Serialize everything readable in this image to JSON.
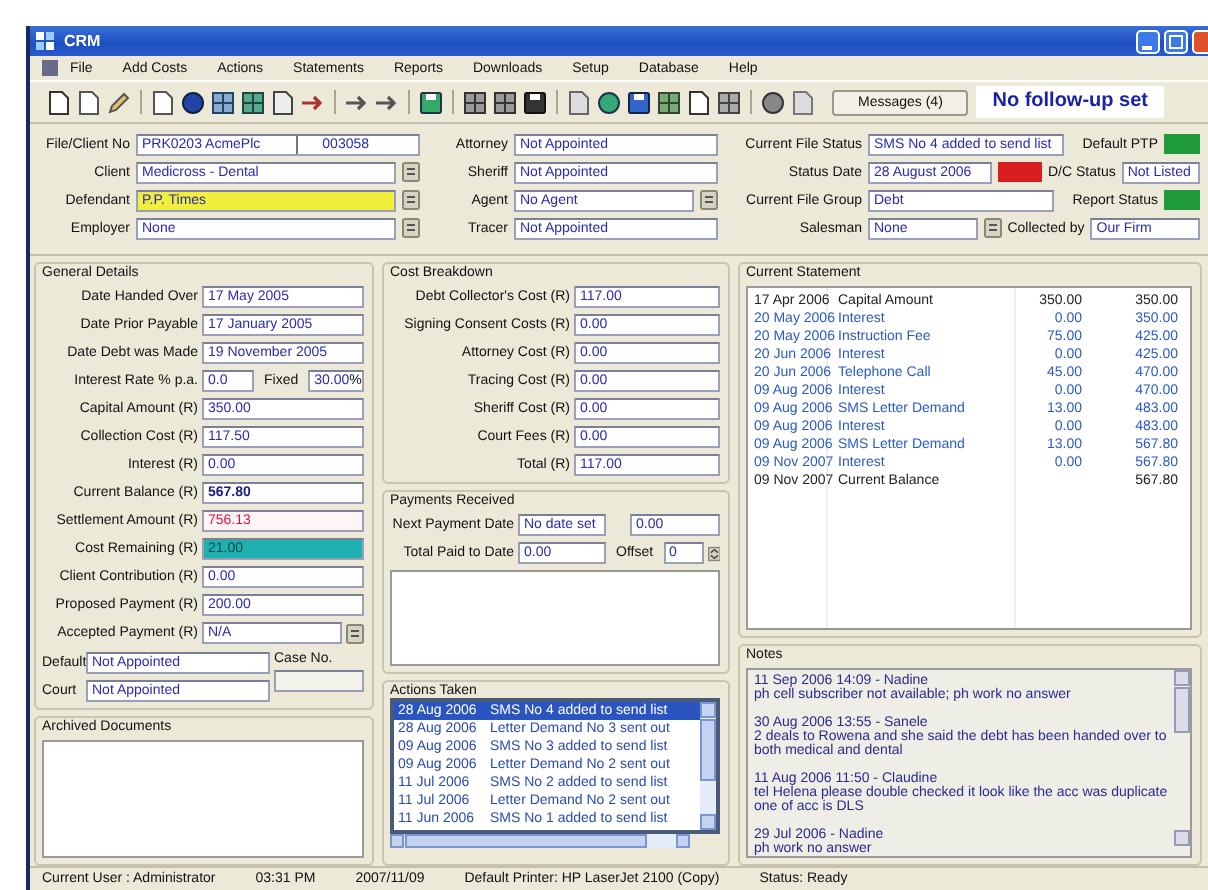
{
  "window": {
    "title": "CRM"
  },
  "menu": [
    "File",
    "Add Costs",
    "Actions",
    "Statements",
    "Reports",
    "Downloads",
    "Setup",
    "Database",
    "Help"
  ],
  "toolbar": {
    "messages_button": "Messages (4)",
    "follow_up": "No follow-up set"
  },
  "header": {
    "columns": [
      {
        "rows": [
          [
            {
              "kind": "field",
              "label": "File/Client No",
              "value": "PRK0203 AcmePlc",
              "value_2": "003058"
            }
          ],
          [
            {
              "kind": "field",
              "label": "Client",
              "value": "Medicross - Dental",
              "lookup": true
            }
          ],
          [
            {
              "kind": "field",
              "label": "Defendant",
              "value": "P.P. Times",
              "lookup": true,
              "color": "#f2ee3c"
            }
          ],
          [
            {
              "kind": "field",
              "label": "Employer",
              "value": "None",
              "lookup": true
            }
          ]
        ]
      },
      {
        "rows": [
          [
            {
              "kind": "field",
              "label": "Attorney",
              "value": "Not Appointed"
            }
          ],
          [
            {
              "kind": "field",
              "label": "Sheriff",
              "value": "Not Appointed"
            }
          ],
          [
            {
              "kind": "field",
              "label": "Agent",
              "value": "No Agent",
              "lookup": true
            }
          ],
          [
            {
              "kind": "field",
              "label": "Tracer",
              "value": "Not Appointed"
            }
          ]
        ]
      },
      {
        "rows": [
          [
            {
              "kind": "field",
              "label": "Current File Status",
              "value": "SMS No 4 added to send list"
            },
            {
              "kind": "indicator",
              "label": "Default PTP",
              "color": "#1e9a3a"
            }
          ],
          [
            {
              "kind": "field",
              "label": "Status Date",
              "value": "28 August 2006"
            },
            {
              "kind": "flag",
              "color": "#d81e1e"
            },
            {
              "kind": "field",
              "label": "D/C Status",
              "value": "Not Listed"
            }
          ],
          [
            {
              "kind": "field",
              "label": "Current File Group",
              "value": "Debt"
            },
            {
              "kind": "indicator",
              "label": "Report Status",
              "color": "#1e9a3a"
            }
          ],
          [
            {
              "kind": "field",
              "label": "Salesman",
              "value": "None",
              "lookup": true
            },
            {
              "kind": "field",
              "label": "Collected by",
              "value": "Our Firm"
            }
          ]
        ]
      }
    ]
  },
  "general": {
    "title": "General Details",
    "rows": [
      {
        "label": "Date Handed Over",
        "value": "17 May 2005"
      },
      {
        "label": "Date Prior Payable",
        "value": "17 January 2005"
      },
      {
        "label": "Date Debt was Made",
        "value": "19 November 2005"
      },
      {
        "label": "Interest Rate % p.a.",
        "value": "0.0",
        "fixed_label": "Fixed",
        "value_2": "30.00",
        "unit": "%"
      },
      {
        "label": "Capital Amount (R)",
        "value": "350.00"
      },
      {
        "label": "Collection Cost (R)",
        "value": "117.50"
      },
      {
        "label": "Interest (R)",
        "value": "0.00"
      },
      {
        "label": "Current Balance (R)",
        "value": "567.80",
        "kind": "bold"
      },
      {
        "label": "Settlement Amount (R)",
        "value": "756.13",
        "kind": "alert"
      },
      {
        "label": "Cost Remaining (R)",
        "value": "21.00",
        "kind": "bar"
      },
      {
        "label": "Client Contribution (R)",
        "value": "0.00"
      },
      {
        "label": "Proposed Payment (R)",
        "value": "200.00"
      },
      {
        "label": "Accepted Payment (R)",
        "value": "N/A",
        "lookup": true
      }
    ],
    "default": {
      "label": "Default",
      "value": "Not Appointed"
    },
    "court": {
      "label": "Court",
      "value": "Not Appointed"
    },
    "case_no": {
      "label": "Case No."
    }
  },
  "archived": {
    "title": "Archived Documents"
  },
  "costs": {
    "title": "Cost Breakdown",
    "rows": [
      {
        "label": "Debt Collector's Cost (R)",
        "value": "117.00"
      },
      {
        "label": "Signing Consent Costs (R)",
        "value": "0.00"
      },
      {
        "label": "Attorney Cost (R)",
        "value": "0.00"
      },
      {
        "label": "Tracing Cost (R)",
        "value": "0.00"
      },
      {
        "label": "Sheriff Cost (R)",
        "value": "0.00"
      },
      {
        "label": "Court Fees (R)",
        "value": "0.00"
      },
      {
        "label": "Total (R)",
        "value": "117.00"
      }
    ]
  },
  "payments": {
    "title": "Payments Received",
    "next_label": "Next Payment Date",
    "next_value": "No date set",
    "next_amount": "0.00",
    "total_label": "Total Paid to Date",
    "total_value": "0.00",
    "offset_label": "Offset",
    "offset_value": "0"
  },
  "actions": {
    "title": "Actions Taken",
    "rows": [
      {
        "date": "28 Aug 2006",
        "text": "SMS No 4 added to send list",
        "selected": true
      },
      {
        "date": "28 Aug 2006",
        "text": "Letter Demand No 3 sent out",
        "selected": false
      },
      {
        "date": "09 Aug 2006",
        "text": "SMS No 3 added to send list",
        "selected": false
      },
      {
        "date": "09 Aug 2006",
        "text": "Letter Demand No 2 sent out",
        "selected": false
      },
      {
        "date": "11 Jul 2006",
        "text": "SMS No 2 added to send list",
        "selected": false
      },
      {
        "date": "11 Jul 2006",
        "text": "Letter Demand No 2 sent out",
        "selected": false
      },
      {
        "date": "11 Jun 2006",
        "text": "SMS No 1 added to send list",
        "selected": false
      }
    ]
  },
  "statement": {
    "title": "Current Statement",
    "rows": [
      {
        "date": "17 Apr 2006",
        "item": "Capital Amount",
        "amount": "350.00",
        "balance": "350.00",
        "kind": "opening"
      },
      {
        "date": "20 May 2006",
        "item": "Interest",
        "amount": "0.00",
        "balance": "350.00",
        "kind": "entry"
      },
      {
        "date": "20 May 2006",
        "item": "Instruction Fee",
        "amount": "75.00",
        "balance": "425.00",
        "kind": "entry"
      },
      {
        "date": "20 Jun 2006",
        "item": "Interest",
        "amount": "0.00",
        "balance": "425.00",
        "kind": "entry"
      },
      {
        "date": "20 Jun 2006",
        "item": "Telephone Call",
        "amount": "45.00",
        "balance": "470.00",
        "kind": "entry"
      },
      {
        "date": "09 Aug 2006",
        "item": "Interest",
        "amount": "0.00",
        "balance": "470.00",
        "kind": "entry"
      },
      {
        "date": "09 Aug 2006",
        "item": "SMS Letter Demand",
        "amount": "13.00",
        "balance": "483.00",
        "kind": "entry"
      },
      {
        "date": "09 Aug 2006",
        "item": "Interest",
        "amount": "0.00",
        "balance": "483.00",
        "kind": "entry"
      },
      {
        "date": "09 Aug 2006",
        "item": "SMS Letter Demand",
        "amount": "13.00",
        "balance": "567.80",
        "kind": "entry"
      },
      {
        "date": "09 Nov 2007",
        "item": "Interest",
        "amount": "0.00",
        "balance": "567.80",
        "kind": "entry"
      },
      {
        "date": "09 Nov 2007",
        "item": "Current Balance",
        "balance": "567.80",
        "kind": "total"
      }
    ]
  },
  "notes": {
    "title": "Notes",
    "entries": [
      {
        "heading": "11 Sep 2006 14:09 - Nadine",
        "text": "ph cell subscriber not available; ph work no answer"
      },
      {
        "heading": "30 Aug 2006 13:55 - Sanele",
        "text": "2 deals to Rowena and she said the debt has been handed over to both medical and dental"
      },
      {
        "heading": "11 Aug 2006 11:50 - Claudine",
        "text": "tel Helena please double checked it look like the acc was duplicate one of acc is DLS"
      },
      {
        "heading": "29 Jul 2006 - Nadine",
        "text": "ph work no answer"
      }
    ]
  },
  "status_bar": [
    "Current User : Administrator",
    "03:31 PM",
    "2007/11/09",
    "Default Printer: HP LaserJet 2100 (Copy)",
    "Status: Ready"
  ]
}
